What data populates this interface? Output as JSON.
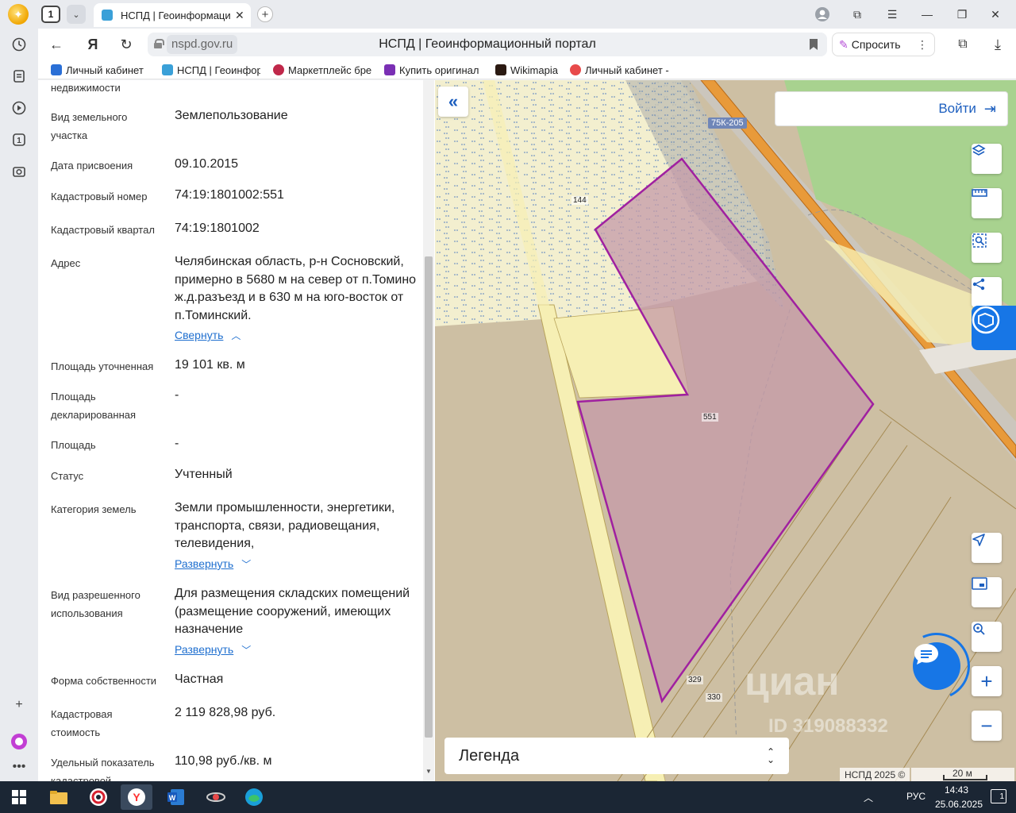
{
  "browser": {
    "tab_count": "1",
    "active_tab_title": "НСПД | Геоинформаци",
    "domain": "nspd.gov.ru",
    "page_title": "НСПД | Геоинформационный портал",
    "ask_label": "Спросить",
    "bookmarks": [
      {
        "label": "Личный кабинет",
        "color": "#2a6fd6"
      },
      {
        "label": "НСПД | Геоинфор",
        "color": "#3aa0d8"
      },
      {
        "label": "Маркетплейс бре",
        "color": "#c0284a"
      },
      {
        "label": "Купить оригинал",
        "color": "#7a2fb4"
      },
      {
        "label": "Wikimapia",
        "color": "#2b1a12"
      },
      {
        "label": "Личный кабинет -",
        "color": "#e84a4a"
      }
    ]
  },
  "panel": {
    "rows": [
      {
        "label": "недвижимости",
        "value": ""
      },
      {
        "label": "Вид земельного участка",
        "value": "Землепользование"
      },
      {
        "label": "Дата присвоения",
        "value": "09.10.2015"
      },
      {
        "label": "Кадастровый номер",
        "value": "74:19:1801002:551"
      },
      {
        "label": "Кадастровый квартал",
        "value": "74:19:1801002"
      },
      {
        "label": "Адрес",
        "value": "Челябинская область, р-н Сосновский, примерно в 5680 м на север от п.Томино ж.д.разъезд и в 630 м на юго-восток от п.Томинский."
      },
      {
        "label": "Площадь уточненная",
        "value": "19 101 кв. м"
      },
      {
        "label": "Площадь декларированная",
        "value": "-"
      },
      {
        "label": "Площадь",
        "value": "-"
      },
      {
        "label": "Статус",
        "value": "Учтенный"
      },
      {
        "label": "Категория земель",
        "value": "Земли промышленности, энергетики, транспорта, связи, радиовещания, телевидения,"
      },
      {
        "label": "Вид разрешенного использования",
        "value": "Для размещения складских помещений (размещение сооружений, имеющих назначение"
      },
      {
        "label": "Форма собственности",
        "value": "Частная"
      },
      {
        "label": "Кадастровая стоимость",
        "value": "2 119 828,98 руб."
      },
      {
        "label": "Удельный показатель кадастровой",
        "value": "110,98 руб./кв. м"
      }
    ],
    "collapse_label": "Свернуть",
    "expand_label": "Развернуть"
  },
  "map": {
    "login_label": "Войти",
    "legend_label": "Легенда",
    "road_label": "75К-205",
    "parcel_labels": [
      "144",
      "551",
      "329",
      "330"
    ],
    "copyright": "НСПД 2025 ©",
    "scale_label": "20 м",
    "watermark": "циан",
    "watermark_id": "ID 319088332",
    "colors": {
      "highlight_stroke": "#a020a0",
      "highlight_fill": "#c49aa8",
      "parcel_yellow": "#f6efb4",
      "forest": "#a8d28f",
      "road": "#e89a3a"
    }
  },
  "taskbar": {
    "lang": "РУС",
    "time": "14:43",
    "date": "25.06.2025",
    "notifications": "1"
  }
}
